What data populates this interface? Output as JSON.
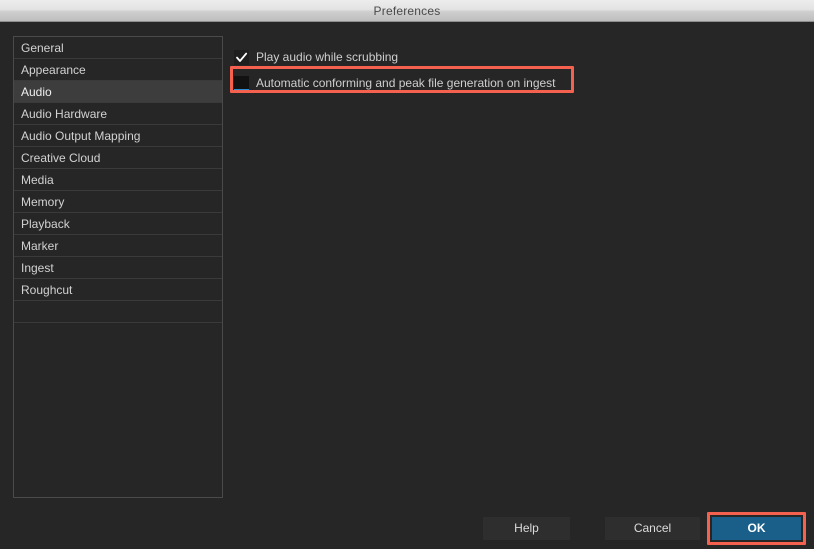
{
  "window": {
    "title": "Preferences"
  },
  "sidebar": {
    "selected": "Audio",
    "items": [
      {
        "label": "General"
      },
      {
        "label": "Appearance"
      },
      {
        "label": "Audio"
      },
      {
        "label": "Audio Hardware"
      },
      {
        "label": "Audio Output Mapping"
      },
      {
        "label": "Creative Cloud"
      },
      {
        "label": "Media"
      },
      {
        "label": "Memory"
      },
      {
        "label": "Playback"
      },
      {
        "label": "Marker"
      },
      {
        "label": "Ingest"
      },
      {
        "label": "Roughcut"
      }
    ]
  },
  "content": {
    "options": [
      {
        "label": "Play audio while scrubbing",
        "checked": "true",
        "icon": "checkmark-icon"
      },
      {
        "label": "Automatic conforming and peak file generation on ingest",
        "checked": "false",
        "icon": "empty-checkbox-icon"
      }
    ]
  },
  "footer": {
    "help_label": "Help",
    "cancel_label": "Cancel",
    "ok_label": "OK"
  },
  "annotations": {
    "highlight_color": "#f4614f",
    "targets": [
      "automatic-conforming-checkbox-row",
      "ok-button"
    ]
  },
  "colors": {
    "accent": "#1a5f8a",
    "focus": "#2b8fd4",
    "window_background": "#262626",
    "selected_row": "#3d3d3d",
    "titlebar_text": "#4a4a4a"
  }
}
